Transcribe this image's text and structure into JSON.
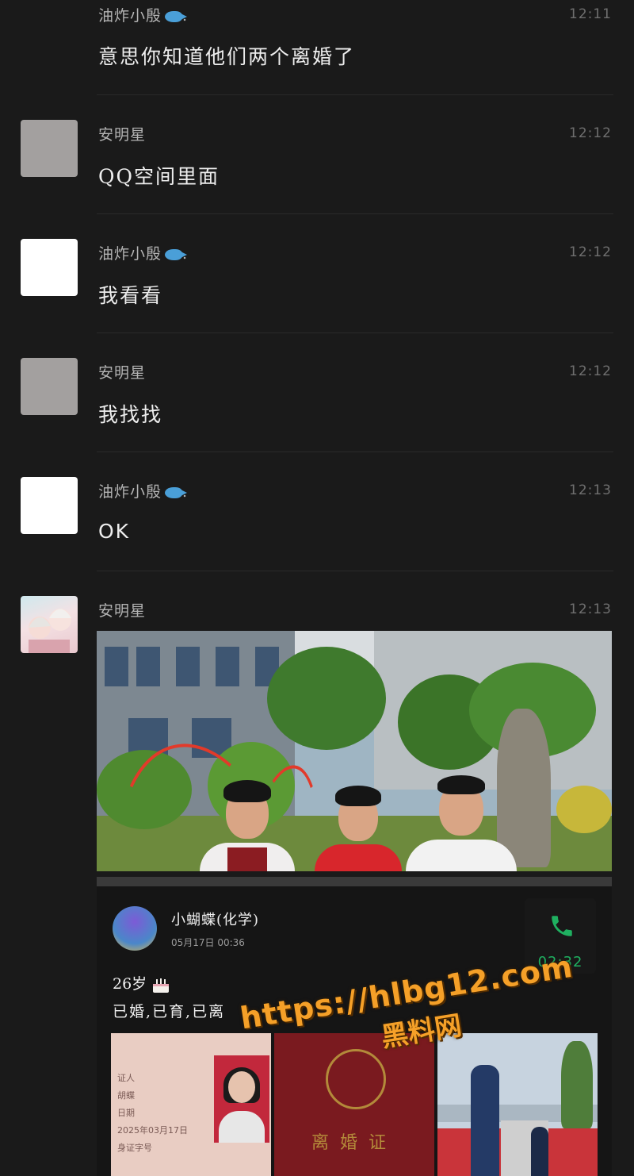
{
  "messages": [
    {
      "sender": "油炸小殷",
      "time": "12:11",
      "text": "意思你知道他们两个离婚了"
    },
    {
      "sender": "安明星",
      "time": "12:12",
      "text": "QQ空间里面"
    },
    {
      "sender": "油炸小殷",
      "time": "12:12",
      "text": "我看看"
    },
    {
      "sender": "安明星",
      "time": "12:12",
      "text": "我找找"
    },
    {
      "sender": "油炸小殷",
      "time": "12:13",
      "text": "OK"
    },
    {
      "sender": "安明星",
      "time": "12:13",
      "text": ""
    }
  ],
  "name_suffix": ".",
  "card": {
    "name": "小蝴蝶(化学)",
    "date": "05月17日 00:36",
    "call_time": "02:32",
    "line1": "26岁",
    "line2": "已婚,已育,已离",
    "thumb1_lines": [
      "证人",
      "胡蝶",
      "日期",
      "2025年03月17日",
      "身证字号"
    ],
    "thumb2_title": "离婚证"
  },
  "watermark": {
    "url": "https://hlbg12.com",
    "label": "黑料网"
  },
  "colors": {
    "background": "#1a1a1a",
    "call_green": "#1fb060",
    "watermark": "#f5a028"
  },
  "icons": [
    "fish-emoji-icon",
    "phone-icon",
    "cake-icon"
  ]
}
